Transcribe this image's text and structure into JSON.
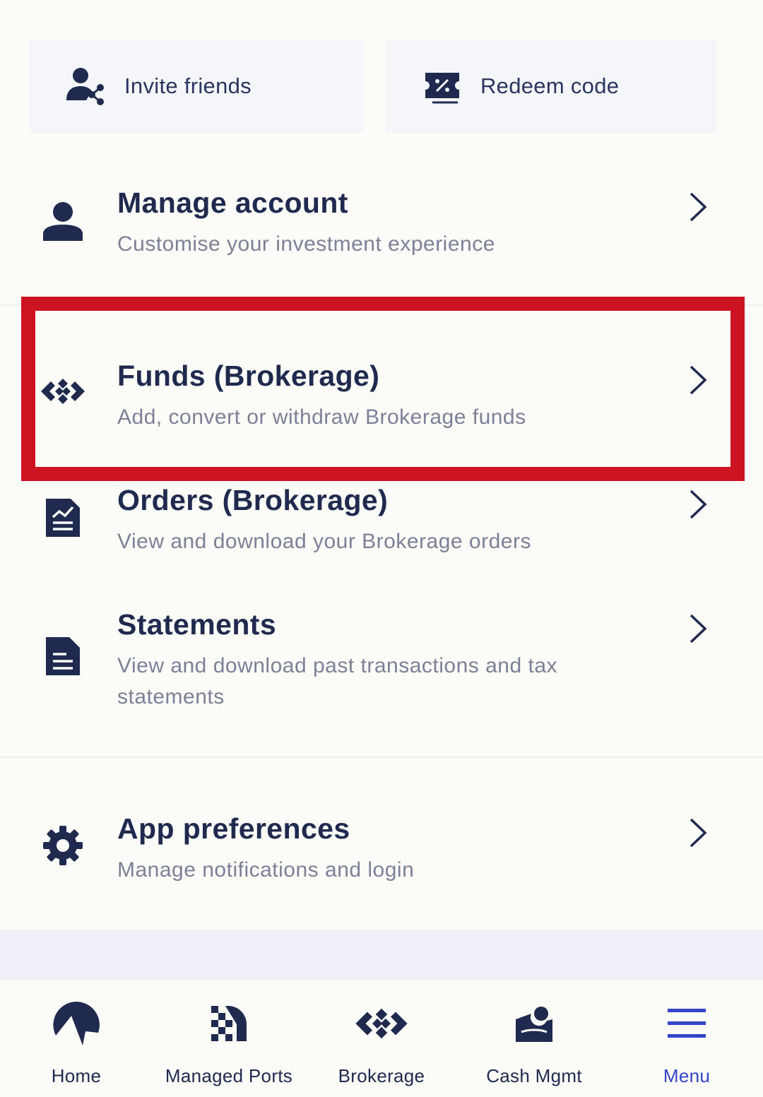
{
  "top_actions": {
    "invite_label": "Invite friends",
    "redeem_label": "Redeem code"
  },
  "menu_items": [
    {
      "title": "Manage account",
      "subtitle": "Customise your investment experience",
      "icon": "person-icon"
    },
    {
      "title": "Funds (Brokerage)",
      "subtitle": "Add, convert or withdraw Brokerage funds",
      "icon": "brokerage-diamond-icon"
    },
    {
      "title": "Orders (Brokerage)",
      "subtitle": "View and download your Brokerage orders",
      "icon": "orders-document-icon"
    },
    {
      "title": "Statements",
      "subtitle": "View and download past transactions and tax statements",
      "icon": "statement-document-icon"
    },
    {
      "title": "App preferences",
      "subtitle": "Manage notifications and login",
      "icon": "gear-icon"
    }
  ],
  "bottom_nav": [
    {
      "label": "Home",
      "icon": "home-icon",
      "active": false
    },
    {
      "label": "Managed Ports",
      "icon": "managed-ports-icon",
      "active": false
    },
    {
      "label": "Brokerage",
      "icon": "brokerage-diamond-icon",
      "active": false
    },
    {
      "label": "Cash Mgmt",
      "icon": "cash-mgmt-icon",
      "active": false
    },
    {
      "label": "Menu",
      "icon": "hamburger-menu-icon",
      "active": true
    }
  ],
  "colors": {
    "primary_text": "#1F2A4E",
    "secondary_text": "#7C8197",
    "active_nav": "#3446C8",
    "highlight": "#CC1322",
    "card_bg": "#F4F6FA",
    "page_bg": "#FBFBF8"
  }
}
